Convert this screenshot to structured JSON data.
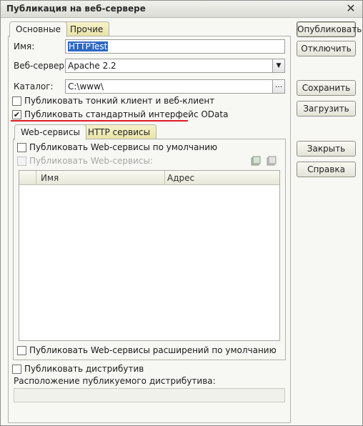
{
  "window": {
    "title": "Публикация на веб-сервере"
  },
  "tabs": {
    "main": "Основные",
    "other": "Прочие"
  },
  "form": {
    "name_label": "Имя:",
    "name_value": "HTTPTest",
    "webserver_label": "Веб-сервер:",
    "webserver_value": "Apache 2.2",
    "catalog_label": "Каталог:",
    "catalog_value": "C:\\www\\",
    "catalog_button": "...",
    "publish_thin_client": "Публиковать тонкий клиент и веб-клиент",
    "publish_odata": "Публиковать стандартный интерфейс OData",
    "publish_distrib": "Публиковать дистрибутив",
    "distrib_location_label": "Расположение публикуемого дистрибутива:",
    "distrib_location_value": ""
  },
  "inner_tabs": {
    "web_services": "Web-сервисы",
    "http_services": "HTTP сервисы"
  },
  "web_services": {
    "publish_default": "Публиковать Web-сервисы по умолчанию",
    "publish": "Публиковать Web-сервисы:",
    "columns": [
      "Имя",
      "Адрес"
    ],
    "rows": [],
    "publish_ext_default": "Публиковать Web-сервисы расширений по умолчанию"
  },
  "buttons": {
    "publish": "Опубликовать",
    "unpublish": "Отключить",
    "save": "Сохранить",
    "load": "Загрузить",
    "close": "Закрыть",
    "help": "Справка"
  },
  "checks": {
    "publish_thin_client": false,
    "publish_odata": true,
    "ws_publish_default": false,
    "ws_publish": false,
    "ws_publish_ext_default": false,
    "publish_distrib": false
  },
  "colors": {
    "highlight": "#e01b24",
    "selection": "#2d68c4",
    "tab": "#e8e3a9"
  }
}
